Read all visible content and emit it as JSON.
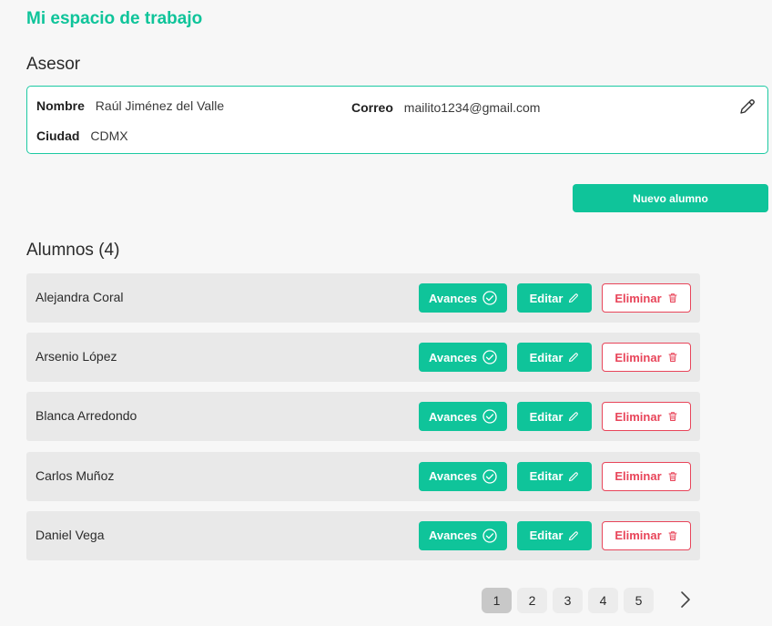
{
  "page_title": "Mi espacio de trabajo",
  "advisor": {
    "section_title": "Asesor",
    "nombre_label": "Nombre",
    "nombre_value": "Raúl Jiménez del Valle",
    "correo_label": "Correo",
    "correo_value": "mailito1234@gmail.com",
    "ciudad_label": "Ciudad",
    "ciudad_value": "CDMX",
    "edit_icon": "pencil-icon"
  },
  "new_student_label": "Nuevo alumno",
  "students": {
    "section_title": "Alumnos (4)",
    "avances_label": "Avances",
    "editar_label": "Editar",
    "eliminar_label": "Eliminar",
    "items": [
      {
        "name": "Alejandra Coral"
      },
      {
        "name": "Arsenio López"
      },
      {
        "name": "Blanca Arredondo"
      },
      {
        "name": "Carlos Muñoz"
      },
      {
        "name": "Daniel Vega"
      }
    ]
  },
  "pagination": {
    "pages": [
      "1",
      "2",
      "3",
      "4",
      "5"
    ],
    "current": "1",
    "next_icon": "chevron-right-icon"
  },
  "colors": {
    "accent": "#0fc49a",
    "danger": "#e8455a",
    "row_bg": "#e9e9e9",
    "page_bg": "#f7f7f7"
  }
}
